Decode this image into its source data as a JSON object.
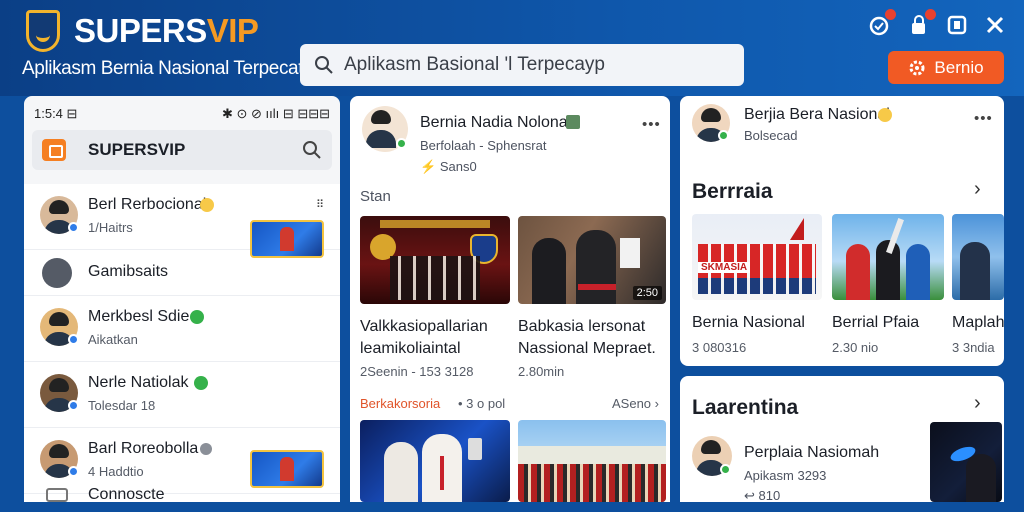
{
  "app": {
    "brand_a": "SUPERS",
    "brand_b": "VIP",
    "tagline": "Aplikasm Bernia Nasional Terpecata"
  },
  "search": {
    "placeholder": "Aplikasm Basional 'l Terpecayp"
  },
  "header_actions": {
    "berita_button": "Bernio",
    "icons": [
      "notification-bell-icon",
      "lock-alert-icon",
      "window-icon",
      "close-icon"
    ]
  },
  "colors": {
    "primary": "#0f57ab",
    "accent": "#f15a24",
    "brand_orange": "#f59a23",
    "verified": "#35b14a"
  },
  "left_panel": {
    "status_time": "1:5:4 ⊟",
    "status_icons": "✱ ⊙ ⊘ ıılı ⊟ ⊟⊟⊟",
    "header_label": "SUPERSVIP",
    "rows": [
      {
        "title": "Berl Rerbocional",
        "sub": "1/Haitrs",
        "has_thumb": true
      },
      {
        "title": "Gamibsaits",
        "sub": "",
        "has_thumb": false
      },
      {
        "title": "Merkbesl Sdie",
        "sub": "Aikatkan",
        "has_thumb": false
      },
      {
        "title": "Nerle Natiolak",
        "sub": "Tolesdar 18",
        "has_thumb": false
      },
      {
        "title": "Barl Roreobolla",
        "sub": "4 Haddtio",
        "has_thumb": true
      },
      {
        "title": "Connoscte",
        "sub": "",
        "has_thumb": false
      }
    ]
  },
  "mid_panel": {
    "author": "Bernia Nadia Nolonal",
    "author_sub": "Berfolaah - Sphensrat",
    "author_meta": "Sans0",
    "section_label": "Stan",
    "cards": [
      {
        "title": "Valkkasiopallarian leamikoliaintal",
        "meta": "2Seenin - 153 3128",
        "duration": ""
      },
      {
        "title": "Babkasia lersonat Nassional Mepraet.",
        "meta": "2.80min",
        "duration": "2:50"
      }
    ],
    "trending_label": "Berkakorsoria",
    "trending_meta": "• 3 o pol",
    "trending_more": "ASeno"
  },
  "right_panel": {
    "author": "Berjia Bera Nasional",
    "author_sub": "Bolsecad",
    "section": "Berrraia",
    "cards": [
      {
        "title": "Bernia Nasional",
        "meta": "3 080316",
        "badge": "SKMASIA"
      },
      {
        "title": "Berrial Pfaia",
        "meta": "2.30 nio",
        "badge": ""
      },
      {
        "title": "Maplah",
        "meta": "3 3ndia",
        "badge": ""
      }
    ]
  },
  "right_panel_2": {
    "section": "Laarentina",
    "item_title": "Perplaia Nasiomah",
    "item_sub": "Apikasm 3293",
    "item_meta": "810"
  }
}
